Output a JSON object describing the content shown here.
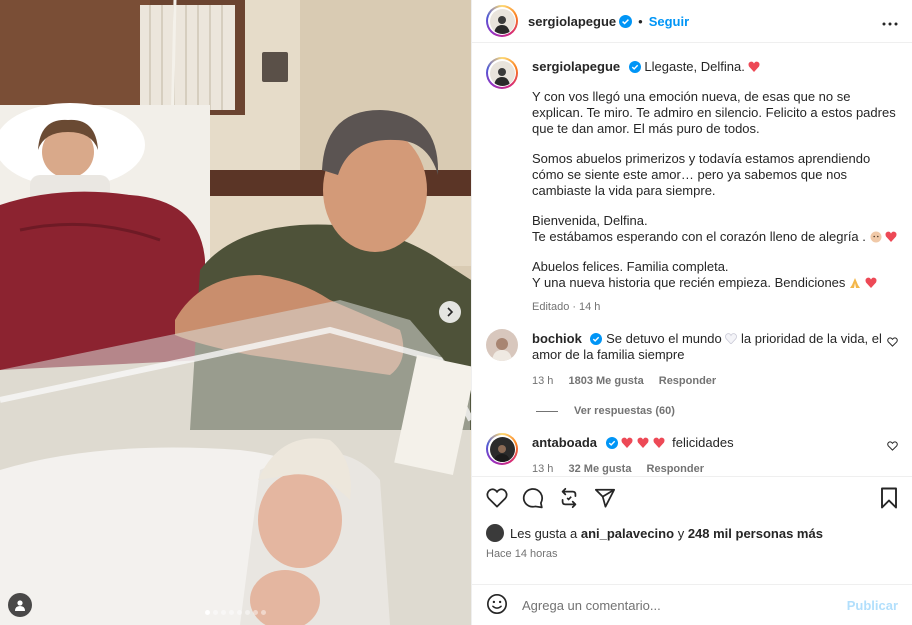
{
  "post": {
    "username": "sergiolapegue",
    "follow_label": "Seguir",
    "sep": "•"
  },
  "caption": {
    "username": "sergiolapegue",
    "line1": "Llegaste, Delfina.",
    "para1": "Y con vos llegó una emoción nueva, de esas que no se explican. Te miro. Te admiro en silencio. Felicito a estos padres que te dan amor. El más puro de todos.",
    "para2": "Somos abuelos primerizos y todavía estamos aprendiendo cómo se siente este amor… pero ya sabemos que nos cambiaste la vida para siempre.",
    "para3a": "Bienvenida, Delfina.",
    "para3b": "Te estábamos esperando con el corazón lleno de alegría .",
    "para4a": "Abuelos felices. Familia completa.",
    "para4b": "Y una nueva historia que recién empieza. Bendiciones",
    "edited": "Editado",
    "dot": "·",
    "time": "14 h"
  },
  "comments": [
    {
      "username": "bochiok",
      "text_a": "Se detuvo el mundo",
      "text_b": "la prioridad de la vida, el amor de la familia siempre",
      "time": "13 h",
      "likes": "1803 Me gusta",
      "reply": "Responder",
      "view_replies": "Ver respuestas (60)"
    },
    {
      "username": "antaboada",
      "text": "felicidades",
      "time": "13 h",
      "likes": "32 Me gusta",
      "reply": "Responder"
    }
  ],
  "likes": {
    "prefix": "Les gusta a",
    "user": "ani_palavecino",
    "mid": "y",
    "count": "248 mil personas más"
  },
  "posted": "Hace 14 horas",
  "composer": {
    "placeholder": "Agrega un comentario...",
    "publish": "Publicar"
  },
  "carousel": {
    "total": 8,
    "active": 0
  },
  "colors": {
    "accent": "#0095f6",
    "heart": "#ed4956",
    "muted": "#737373"
  }
}
